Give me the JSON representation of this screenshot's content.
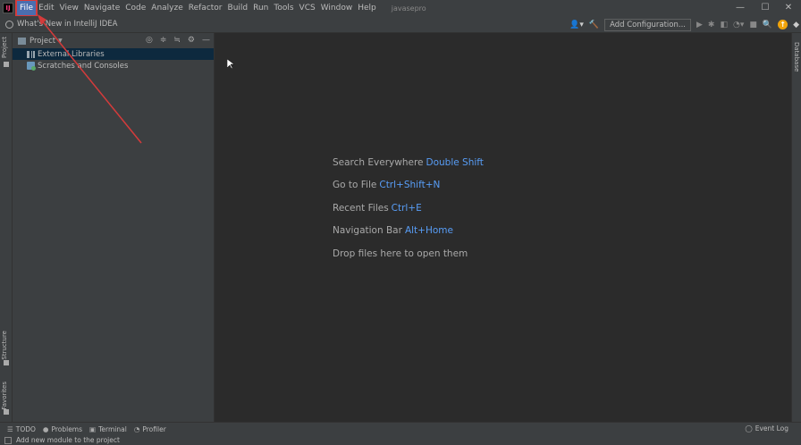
{
  "menubar": {
    "items": [
      "File",
      "Edit",
      "View",
      "Navigate",
      "Code",
      "Analyze",
      "Refactor",
      "Build",
      "Run",
      "Tools",
      "VCS",
      "Window",
      "Help"
    ],
    "project_name": "javasepro",
    "window_controls": [
      "—",
      "☐",
      "✕"
    ]
  },
  "toolbar": {
    "whats_new": "What's New in IntelliJ IDEA",
    "add_configuration": "Add Configuration..."
  },
  "left_stripe": {
    "project": "Project",
    "structure": "Structure",
    "favorites": "Favorites"
  },
  "project_panel": {
    "title": "Project",
    "items": [
      {
        "label": "External Libraries"
      },
      {
        "label": "Scratches and Consoles"
      }
    ]
  },
  "editor": {
    "hints": [
      {
        "label": "Search Everywhere",
        "key": "Double Shift"
      },
      {
        "label": "Go to File",
        "key": "Ctrl+Shift+N"
      },
      {
        "label": "Recent Files",
        "key": "Ctrl+E"
      },
      {
        "label": "Navigation Bar",
        "key": "Alt+Home"
      },
      {
        "label": "Drop files here to open them",
        "key": ""
      }
    ]
  },
  "right_stripe": {
    "database": "Database"
  },
  "bottombar": {
    "todo": "TODO",
    "problems": "Problems",
    "terminal": "Terminal",
    "profiler": "Profiler",
    "event_log": "Event Log"
  },
  "statusbar": {
    "message": "Add new module to the project"
  },
  "colors": {
    "accent": "#4b6eaf",
    "highlight_box": "#d43b3b",
    "shortcut": "#589df6"
  }
}
